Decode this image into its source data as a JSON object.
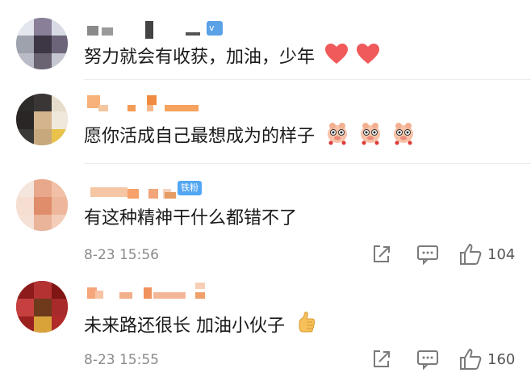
{
  "colors": {
    "heart": "#f05a5a",
    "time": "#8a8a8a",
    "badge_vip": "#5aa1e6",
    "badge_fan": "#52a6f2"
  },
  "comments": [
    {
      "text": "努力就会有收获，加油，少年",
      "emojis": [
        "heart-emoji",
        "heart-emoji"
      ],
      "badge": ""
    },
    {
      "text": "愿你活成自己最想成为的样子",
      "emojis": [
        "pig-emoji",
        "pig-emoji",
        "pig-emoji"
      ],
      "badge": ""
    },
    {
      "text": "有这种精神干什么都错不了",
      "emojis": [],
      "badge": "铁粉",
      "time": "8-23 15:56",
      "likes": "104"
    },
    {
      "text": "未来路还很长 加油小伙子",
      "emojis": [
        "thumbs-up-emoji"
      ],
      "badge": "",
      "time": "8-23 15:55",
      "likes": "160"
    }
  ]
}
